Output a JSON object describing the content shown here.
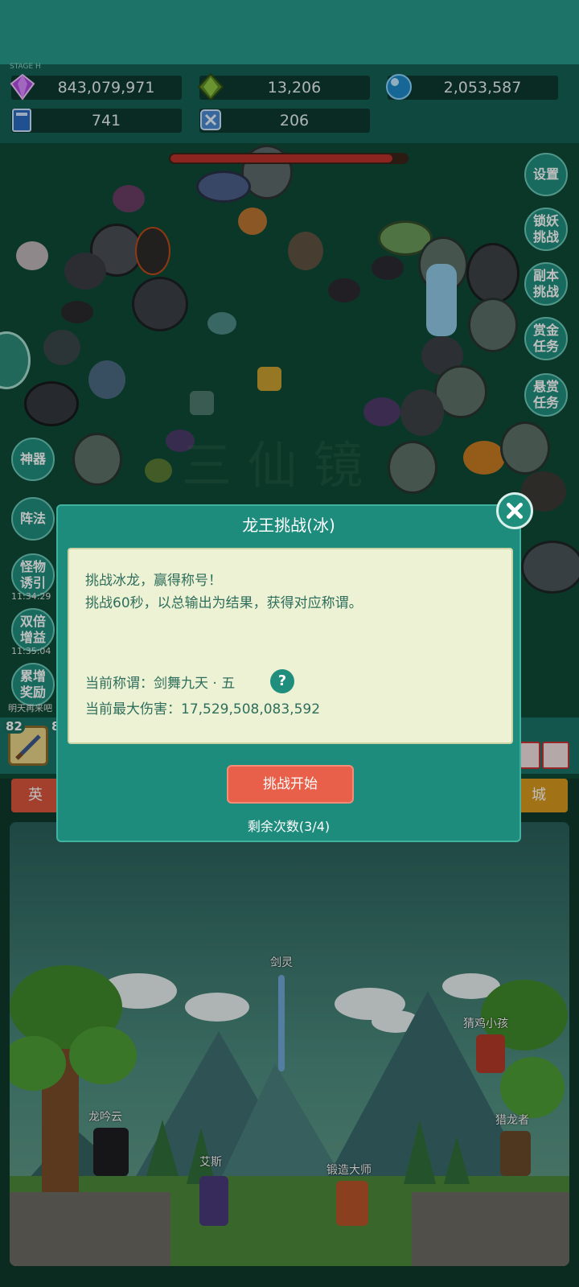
{
  "resources": [
    {
      "icon": "purple-gem-icon",
      "value": "843,079,971"
    },
    {
      "icon": "green-crystal-icon",
      "value": "13,206"
    },
    {
      "icon": "blue-orb-icon",
      "value": "2,053,587"
    },
    {
      "icon": "blue-book-icon",
      "value": "741"
    },
    {
      "icon": "rune-scroll-icon",
      "value": "206"
    }
  ],
  "status_corner": "STAGE H",
  "boss_hp_fraction": 0.94,
  "right_menu": {
    "settings": "设置",
    "lock_demon_1": "锁妖",
    "lock_demon_2": "挑战",
    "dungeon_1": "副本",
    "dungeon_2": "挑战",
    "bounty_1": "赏金",
    "bounty_2": "任务",
    "reward_1": "悬赏",
    "reward_2": "任务"
  },
  "left_menu": {
    "artifact_1": "神器",
    "artifact_2": "",
    "formation": "阵法",
    "lure_1": "怪物",
    "lure_2": "诱引",
    "lure_timer": "11:34:29",
    "double_1": "双倍",
    "double_2": "增益",
    "double_timer": "11:35:04",
    "accum_1": "累增",
    "accum_2": "奖励",
    "accum_note": "明天再来吧"
  },
  "hud": {
    "slot_level_left": "82",
    "slot_level_right": "8",
    "tab_left": "英",
    "tab_right": "城"
  },
  "dialog": {
    "title": "龙王挑战(冰)",
    "line1": "挑战冰龙，赢得称号！",
    "line2": "挑战60秒，以总输出为结果，获得对应称谓。",
    "current_title_label": "当前称谓：剑舞九天 · 五",
    "help": "?",
    "max_damage_label": "当前最大伤害：17,529,508,083,592",
    "start_button": "挑战开始",
    "remaining": "剩余次数(3/4)"
  },
  "scene_characters": {
    "sword_spirit": "剑灵",
    "chicken_kid": "猜鸡小孩",
    "dragon_chant": "龙吟云",
    "dragon_hunter": "猎龙者",
    "ace": "艾斯",
    "master_smith": "锻造大师"
  },
  "colors": {
    "teal": "#1f8e7c",
    "accent_red": "#e8604a",
    "dialog_panel": "#edf2d4",
    "gold_tab": "#d79a1e"
  }
}
